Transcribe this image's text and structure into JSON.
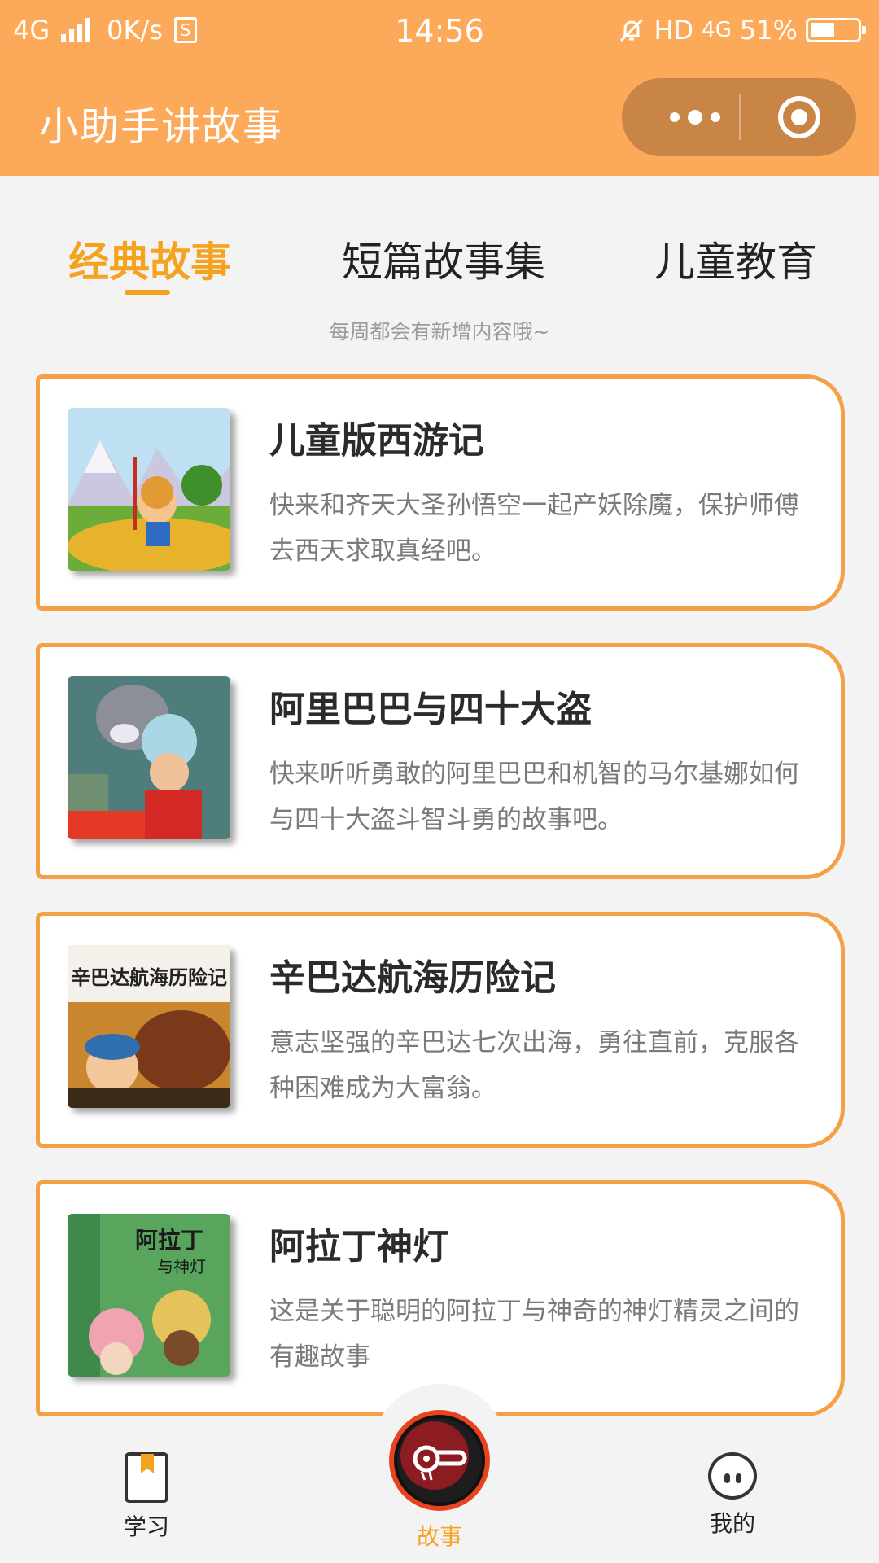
{
  "status_bar": {
    "network": "4G",
    "speed": "0K/s",
    "sim": "S",
    "time": "14:56",
    "hd": "HD",
    "network2": "4G",
    "battery_text": "51%",
    "battery_level": 0.51
  },
  "header": {
    "title": "小助手讲故事"
  },
  "tabs": [
    {
      "label": "经典故事",
      "active": true
    },
    {
      "label": "短篇故事集",
      "active": false
    },
    {
      "label": "儿童教育",
      "active": false
    }
  ],
  "subtitle": "每周都会有新增内容哦~",
  "stories": [
    {
      "title": "儿童版西游记",
      "desc": "快来和齐天大圣孙悟空一起产妖除魔，保护师傅去西天求取真经吧。"
    },
    {
      "title": "阿里巴巴与四十大盗",
      "desc": "快来听听勇敢的阿里巴巴和机智的马尔基娜如何与四十大盗斗智斗勇的故事吧。"
    },
    {
      "title": "辛巴达航海历险记",
      "desc": "意志坚强的辛巴达七次出海，勇往直前，克服各种困难成为大富翁。",
      "cover_text": "辛巴达航海历险记"
    },
    {
      "title": "阿拉丁神灯",
      "desc": "这是关于聪明的阿拉丁与神奇的神灯精灵之间的有趣故事",
      "cover_text_1": "阿拉丁",
      "cover_text_2": "与神灯"
    }
  ],
  "bottom_nav": {
    "study": "学习",
    "story": "故事",
    "me": "我的"
  },
  "colors": {
    "header_bg": "#fda95a",
    "accent": "#f5a21f",
    "card_border": "#f6a046"
  }
}
